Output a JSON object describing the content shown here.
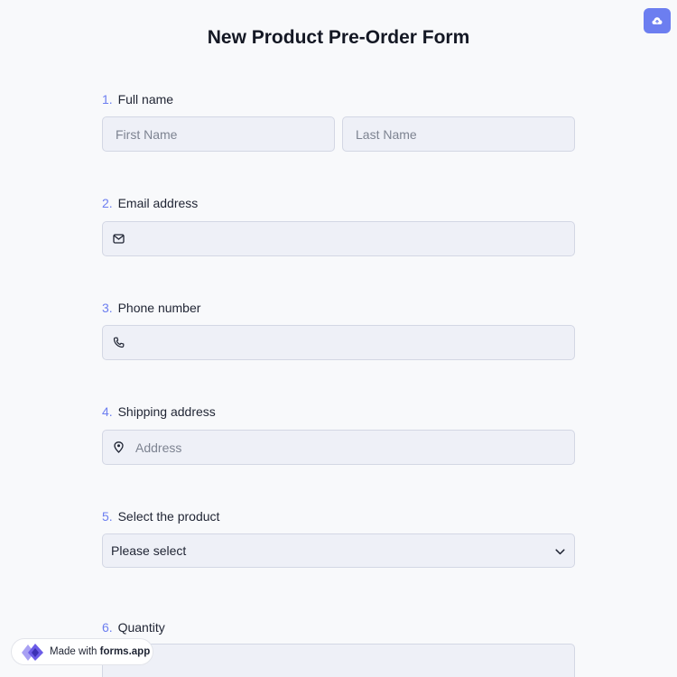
{
  "form": {
    "title": "New Product Pre-Order Form",
    "questions": [
      {
        "number": "1.",
        "label": "Full name",
        "first_placeholder": "First Name",
        "last_placeholder": "Last Name"
      },
      {
        "number": "2.",
        "label": "Email address",
        "icon": "mail-icon"
      },
      {
        "number": "3.",
        "label": "Phone number",
        "icon": "phone-icon"
      },
      {
        "number": "4.",
        "label": "Shipping address",
        "icon": "location-pin-icon",
        "placeholder": "Address"
      },
      {
        "number": "5.",
        "label": "Select the product",
        "selected": "Please select"
      },
      {
        "number": "6.",
        "label": "Quantity"
      }
    ]
  },
  "toolbar": {
    "save_icon": "cloud-upload-icon"
  },
  "badge": {
    "prefix": "Made with",
    "brand": "forms.app"
  },
  "colors": {
    "accent": "#6c7ef0",
    "field_bg": "#eef0f7",
    "page_bg": "#f8f9fb"
  }
}
